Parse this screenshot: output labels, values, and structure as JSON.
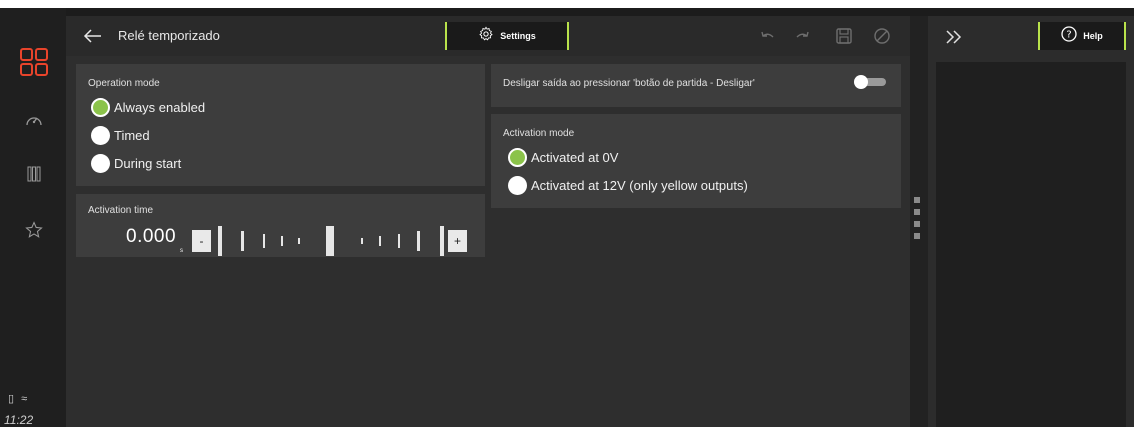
{
  "status_bar": {
    "clock": "11:22"
  },
  "header": {
    "title": "Relé temporizado",
    "settings_tab_label": "Settings"
  },
  "operation_mode": {
    "label": "Operation mode",
    "options": [
      {
        "label": "Always enabled",
        "checked": true
      },
      {
        "label": "Timed",
        "checked": false
      },
      {
        "label": "During start",
        "checked": false
      }
    ]
  },
  "activation_time": {
    "label": "Activation time",
    "value": "0.000",
    "unit": "s",
    "minus_label": "-",
    "plus_label": "+"
  },
  "switch_off_setting": {
    "label": "Desligar saída ao pressionar 'botão de partida - Desligar'",
    "enabled": false
  },
  "activation_mode": {
    "label": "Activation mode",
    "options": [
      {
        "label": "Activated at 0V",
        "checked": true
      },
      {
        "label": "Activated at 12V (only yellow outputs)",
        "checked": false
      }
    ]
  },
  "right_panel": {
    "help_tab_label": "Help"
  },
  "colors": {
    "accent": "#b9e24b",
    "radio_checked": "#8bc34a",
    "brand": "#e8442b"
  }
}
